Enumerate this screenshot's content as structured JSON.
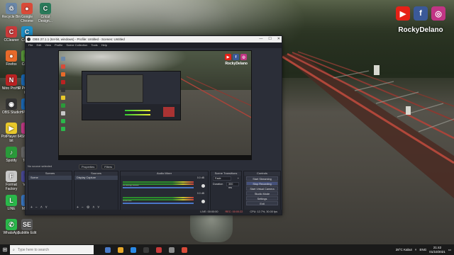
{
  "desktop": {
    "icons": [
      {
        "label": "Recycle Bin",
        "color": "#6a87a8",
        "glyph": "♲"
      },
      {
        "label": "Google Chrome",
        "color": "#d94a38",
        "glyph": "●"
      },
      {
        "label": "Cricut Design...",
        "color": "#2a7a5a",
        "glyph": "C"
      },
      {
        "label": "CCleaner",
        "color": "#c83a3a",
        "glyph": "C"
      },
      {
        "label": "Canv...",
        "color": "#1e90c8",
        "glyph": "C"
      },
      {
        "label": "Firefox",
        "color": "#e86a2a",
        "glyph": "●"
      },
      {
        "label": "Cam...",
        "color": "#5a9a3a",
        "glyph": "C"
      },
      {
        "label": "Nitro Pro 10",
        "color": "#b22",
        "glyph": "N"
      },
      {
        "label": "HP Print Scan D...",
        "color": "#1a6ab8",
        "glyph": "P"
      },
      {
        "label": "OBS Studio",
        "color": "#333",
        "glyph": "◉"
      },
      {
        "label": "HP On...",
        "color": "#1a6ab8",
        "glyph": "H"
      },
      {
        "label": "PotPlayer 64 bit",
        "color": "#e8c82a",
        "glyph": "▶"
      },
      {
        "label": "Shop...",
        "color": "#c83a8a",
        "glyph": "S"
      },
      {
        "label": "Spotify",
        "color": "#2a9a3a",
        "glyph": "♪"
      },
      {
        "label": "Tes...",
        "color": "#6a6a6a",
        "glyph": "T"
      },
      {
        "label": "Format Factory",
        "color": "#c8c8c8",
        "glyph": "F"
      },
      {
        "label": "Vid...",
        "color": "#4a4a9a",
        "glyph": "V"
      },
      {
        "label": "LINE",
        "color": "#2ab84a",
        "glyph": "L"
      },
      {
        "label": "Mob...",
        "color": "#3a7ac8",
        "glyph": "M"
      },
      {
        "label": "WhatsApp",
        "color": "#2ab84a",
        "glyph": "✆"
      },
      {
        "label": "Subtitle Edit",
        "color": "#5a5a5a",
        "glyph": "SE"
      }
    ],
    "social": {
      "youtube": "▶",
      "facebook": "f",
      "instagram": "◎",
      "name": "RockyDelano",
      "colors": {
        "youtube": "#e62117",
        "facebook": "#3b5998",
        "instagram": "#c13584"
      }
    }
  },
  "obs": {
    "title": "OBS 27.1.1 (64-bit, windows) - Profile: Untitled - Scenes: Untitled",
    "window_buttons": [
      "—",
      "☐",
      "✕"
    ],
    "menu": [
      "File",
      "Edit",
      "View",
      "Profile",
      "Scene Collection",
      "Tools",
      "Help"
    ],
    "preview_name": "RockyDelano",
    "no_source": "No source selected",
    "properties": "Properties",
    "filters": "Filters",
    "docks": {
      "scenes": {
        "title": "Scenes",
        "items": [
          "Scene"
        ]
      },
      "sources": {
        "title": "Sources",
        "items": [
          "Display Capture"
        ]
      },
      "mixer": {
        "title": "Audio Mixer",
        "channels": [
          {
            "name": "Desktop Audio",
            "db": "0.0 dB"
          },
          {
            "name": "Mic/Aux",
            "db": "0.0 dB"
          }
        ]
      },
      "transitions": {
        "title": "Scene Transitions",
        "type": "Fade",
        "duration_label": "Duration",
        "duration": "300 ms"
      },
      "controls": {
        "title": "Controls",
        "buttons": [
          "Start Streaming",
          "Stop Recording",
          "Start Virtual Camera",
          "Studio Mode",
          "Settings",
          "Exit"
        ]
      }
    },
    "status": {
      "live": "LIVE: 00:00:00",
      "rec": "REC: 00:00:22",
      "cpu": "CPU: 12.7%, 30.00 fps"
    }
  },
  "taskbar": {
    "start": "⊞",
    "search_placeholder": "Type here to search",
    "weather": "28°C  Kabut",
    "lang": "ENG",
    "time": "21:42",
    "date": "01/10/2021",
    "apps": [
      "#4a7ac8",
      "#e8a82a",
      "#2a8ae8",
      "#3a3a3a",
      "#c83a3a",
      "#8a8a8a",
      "#d94a38"
    ]
  }
}
